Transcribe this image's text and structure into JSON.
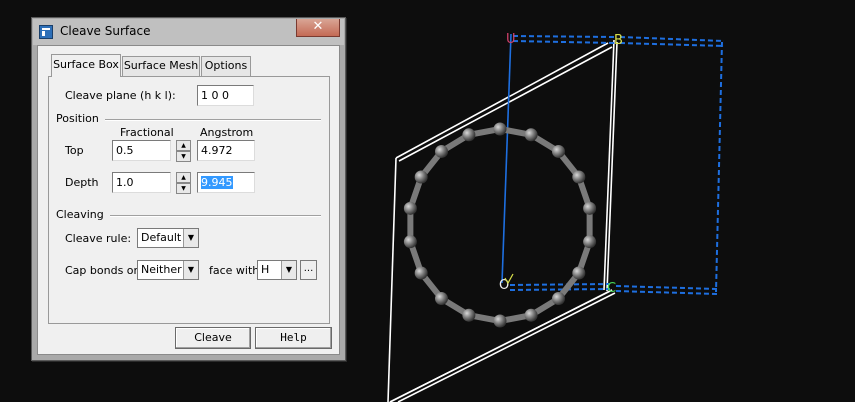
{
  "dialog": {
    "title": "Cleave Surface",
    "close_label": "✕",
    "tabs": [
      {
        "label": "Surface Box",
        "active": true
      },
      {
        "label": "Surface Mesh",
        "active": false
      },
      {
        "label": "Options",
        "active": false
      }
    ],
    "cleave_plane": {
      "label": "Cleave plane (h k l):",
      "value": "1  0  0"
    },
    "position": {
      "section_label": "Position",
      "col_fractional": "Fractional",
      "col_angstrom": "Angstrom",
      "top": {
        "label": "Top",
        "fractional": "0.5",
        "angstrom": "4.972"
      },
      "depth": {
        "label": "Depth",
        "fractional": "1.0",
        "angstrom": "9.945"
      }
    },
    "cleaving": {
      "section_label": "Cleaving",
      "rule_label": "Cleave rule:",
      "rule_value": "Default",
      "cap_label": "Cap bonds on",
      "cap_value": "Neither",
      "face_label": "face with",
      "face_value": "H",
      "more_label": "..."
    },
    "buttons": {
      "cleave": "Cleave",
      "help": "Help"
    }
  },
  "viewport": {
    "background": "#0d0d0d",
    "atom_color": "#8a8a8a",
    "lattice_color": "#1e6fe0",
    "plane_color": "#ffffff",
    "axis_labels": {
      "u": "U",
      "b": "B",
      "c": "C",
      "origin": "O"
    }
  }
}
